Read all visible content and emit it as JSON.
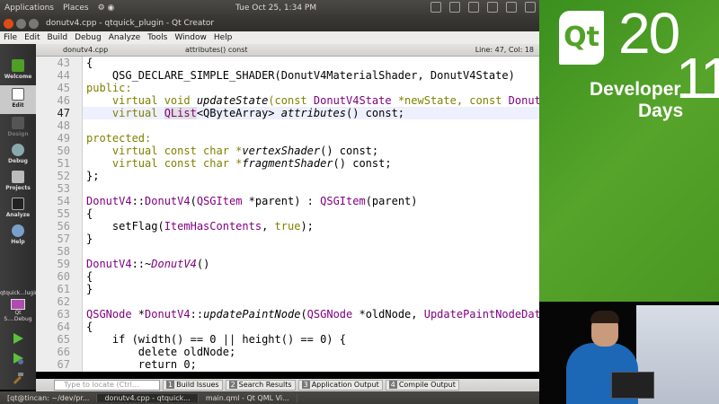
{
  "panel": {
    "applications": "Applications",
    "places": "Places",
    "clock": "Tue Oct 25,  1:34 PM"
  },
  "window": {
    "title": "donutv4.cpp - qtquick_plugin - Qt Creator"
  },
  "menu": [
    "File",
    "Edit",
    "Build",
    "Debug",
    "Analyze",
    "Tools",
    "Window",
    "Help"
  ],
  "modes": [
    {
      "label": "Welcome",
      "icon": "qt-logo-icon"
    },
    {
      "label": "Edit",
      "icon": "document-edit-icon"
    },
    {
      "label": "Design",
      "icon": "design-pen-icon"
    },
    {
      "label": "Debug",
      "icon": "debug-bug-icon"
    },
    {
      "label": "Projects",
      "icon": "projects-wrench-icon"
    },
    {
      "label": "Analyze",
      "icon": "analyze-monitor-icon"
    },
    {
      "label": "Help",
      "icon": "help-icon"
    }
  ],
  "kit": {
    "project": "qtquick...lugin",
    "config": "Qt S....Debug"
  },
  "editor": {
    "file": "donutv4.cpp",
    "symbol": "attributes() const",
    "position": "Line: 47, Col: 18"
  },
  "code": {
    "l43": "{",
    "l44": "    QSG_DECLARE_SIMPLE_SHADER(DonutV4MaterialShader, DonutV4State)",
    "l45": "public:",
    "l46a": "    virtual void ",
    "l46b": "updateState",
    "l46c": "(const ",
    "l46d": "DonutV4State",
    "l46e": " *newState, const ",
    "l46f": "DonutV",
    "l47a": "    virtual ",
    "l47b": "QList",
    "l47c": "<QByteArray> ",
    "l47d": "attributes",
    "l47e": "() const;",
    "l49": "protected:",
    "l50a": "    virtual const char *",
    "l50b": "vertexShader",
    "l50c": "() const;",
    "l51a": "    virtual const char *",
    "l51b": "fragmentShader",
    "l51c": "() const;",
    "l52": "};",
    "l54a": "DonutV4",
    "l54b": "::",
    "l54c": "DonutV4",
    "l54d": "(",
    "l54e": "QSGItem",
    "l54f": " *parent) : ",
    "l54g": "QSGItem",
    "l54h": "(parent)",
    "l55": "{",
    "l56a": "    setFlag(",
    "l56b": "ItemHasContents",
    "l56c": ", ",
    "l56d": "true",
    "l56e": ");",
    "l57": "}",
    "l59a": "DonutV4",
    "l59b": "::~",
    "l59c": "DonutV4",
    "l59d": "()",
    "l60": "{",
    "l61": "}",
    "l63a": "QSGNode",
    "l63b": " *",
    "l63c": "DonutV4",
    "l63d": "::",
    "l63e": "updatePaintNode",
    "l63f": "(",
    "l63g": "QSGNode",
    "l63h": " *oldNode, ",
    "l63i": "UpdatePaintNodeData",
    "l64": "{",
    "l65": "    if (width() == 0 || height() == 0) {",
    "l66": "        delete oldNode;",
    "l67": "        return 0;"
  },
  "line_numbers": [
    "43",
    "44",
    "45",
    "46",
    "47",
    "48",
    "49",
    "50",
    "51",
    "52",
    "53",
    "54",
    "55",
    "56",
    "57",
    "58",
    "59",
    "60",
    "61",
    "62",
    "63",
    "64",
    "65",
    "66",
    "67"
  ],
  "output": {
    "locate_placeholder": "Type to locate (Ctrl...",
    "tabs": [
      {
        "num": "1",
        "label": "Build Issues"
      },
      {
        "num": "2",
        "label": "Search Results"
      },
      {
        "num": "3",
        "label": "Application Output"
      },
      {
        "num": "4",
        "label": "Compile Output"
      }
    ]
  },
  "taskbar": [
    "[qt@tincan: ~/dev/pr...",
    "donutv4.cpp - qtquick...",
    "main.qml - Qt QML Vi..."
  ],
  "banner": {
    "logo": "Qt",
    "year_top": "20",
    "year_bottom": "11",
    "line1": "Developer",
    "line2": "Days"
  },
  "colors": {
    "keyword": "#808000",
    "type": "#800080",
    "banner_green": "#4f9e26"
  }
}
